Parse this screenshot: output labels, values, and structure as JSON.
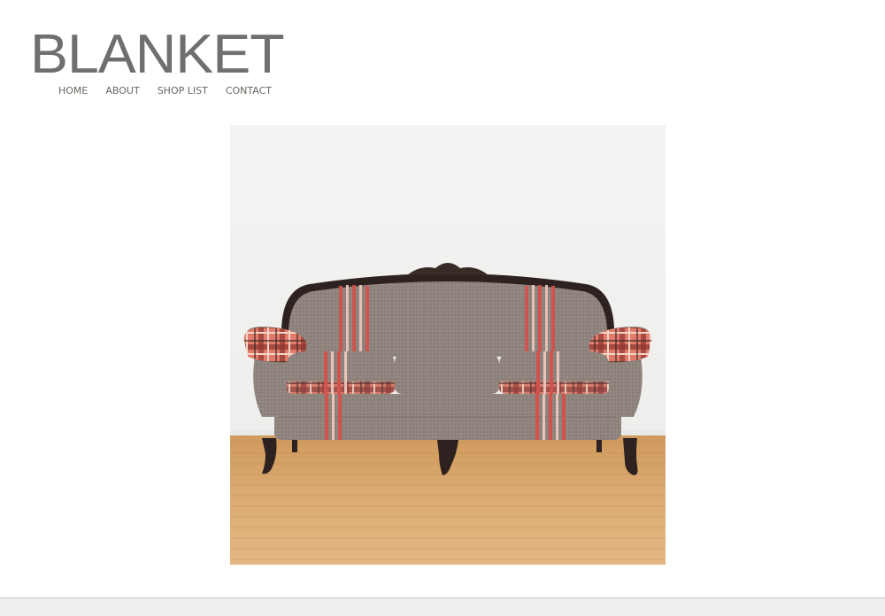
{
  "site": {
    "logo_text": "BLANKET"
  },
  "nav": {
    "items": [
      {
        "label": "HOME"
      },
      {
        "label": "ABOUT"
      },
      {
        "label": "SHOP LIST"
      },
      {
        "label": "CONTACT"
      }
    ]
  },
  "colors": {
    "logo": "#6f6f72",
    "nav_text": "#6b6660",
    "footer_bg": "#f1eeee",
    "sofa_fabric": "#8e827c",
    "plaid_red": "#d2524d",
    "wood_floor": "#d6a367",
    "sofa_frame": "#2e2220"
  },
  "hero": {
    "image_name": "plaid-sofa-photo"
  }
}
